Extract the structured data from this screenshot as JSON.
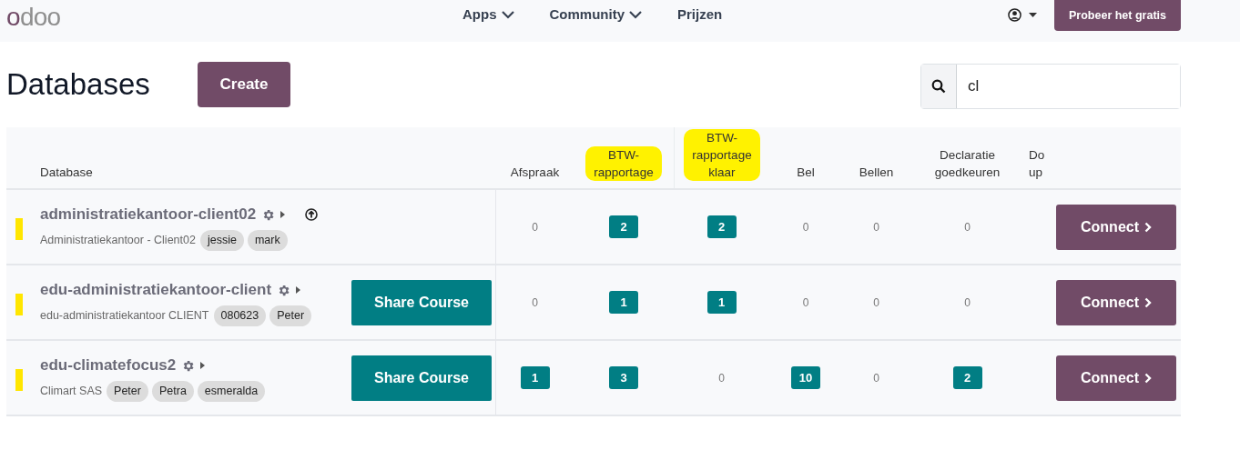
{
  "nav": {
    "logo": "odoo",
    "links": [
      {
        "label": "Apps",
        "dropdown": true
      },
      {
        "label": "Community",
        "dropdown": true
      },
      {
        "label": "Prijzen",
        "dropdown": false
      }
    ],
    "cta": "Probeer het gratis"
  },
  "page": {
    "title": "Databases",
    "create": "Create",
    "search": {
      "value": "cl"
    }
  },
  "table": {
    "columns": [
      {
        "label": "Database",
        "highlighted": false
      },
      {
        "label": "Afspraak",
        "highlighted": false
      },
      {
        "label": "BTW-rapportage",
        "highlighted": true
      },
      {
        "label": "BTW-rapportage klaar",
        "highlighted": true
      },
      {
        "label": "Bel",
        "highlighted": false
      },
      {
        "label": "Bellen",
        "highlighted": false
      },
      {
        "label": "Declaratie goedkeuren",
        "highlighted": false
      },
      {
        "label": "Do up",
        "highlighted": false
      }
    ],
    "rows": [
      {
        "name": "administratiekantoor-client02",
        "marked": true,
        "upload": true,
        "company": "Administratiekantoor - Client02",
        "tags": [
          "jessie",
          "mark"
        ],
        "share": null,
        "counts": [
          {
            "value": "0",
            "kind": "plain"
          },
          {
            "value": "2",
            "kind": "badge"
          },
          {
            "value": "2",
            "kind": "badge"
          },
          {
            "value": "0",
            "kind": "plain"
          },
          {
            "value": "0",
            "kind": "plain"
          },
          {
            "value": "0",
            "kind": "plain"
          }
        ],
        "connect": "Connect"
      },
      {
        "name": "edu-administratiekantoor-client",
        "marked": true,
        "upload": false,
        "company": "edu-administratiekantoor CLIENT",
        "tags": [
          "080623",
          "Peter"
        ],
        "share": "Share Course",
        "counts": [
          {
            "value": "0",
            "kind": "plain"
          },
          {
            "value": "1",
            "kind": "badge"
          },
          {
            "value": "1",
            "kind": "badge"
          },
          {
            "value": "0",
            "kind": "plain"
          },
          {
            "value": "0",
            "kind": "plain"
          },
          {
            "value": "0",
            "kind": "plain"
          }
        ],
        "connect": "Connect"
      },
      {
        "name": "edu-climatefocus2",
        "marked": true,
        "upload": false,
        "company": "Climart SAS",
        "tags": [
          "Peter",
          "Petra",
          "esmeralda"
        ],
        "share": "Share Course",
        "counts": [
          {
            "value": "1",
            "kind": "badge"
          },
          {
            "value": "3",
            "kind": "badge"
          },
          {
            "value": "0",
            "kind": "plain"
          },
          {
            "value": "10",
            "kind": "badge"
          },
          {
            "value": "0",
            "kind": "plain"
          },
          {
            "value": "2",
            "kind": "badge"
          }
        ],
        "connect": "Connect"
      }
    ]
  }
}
